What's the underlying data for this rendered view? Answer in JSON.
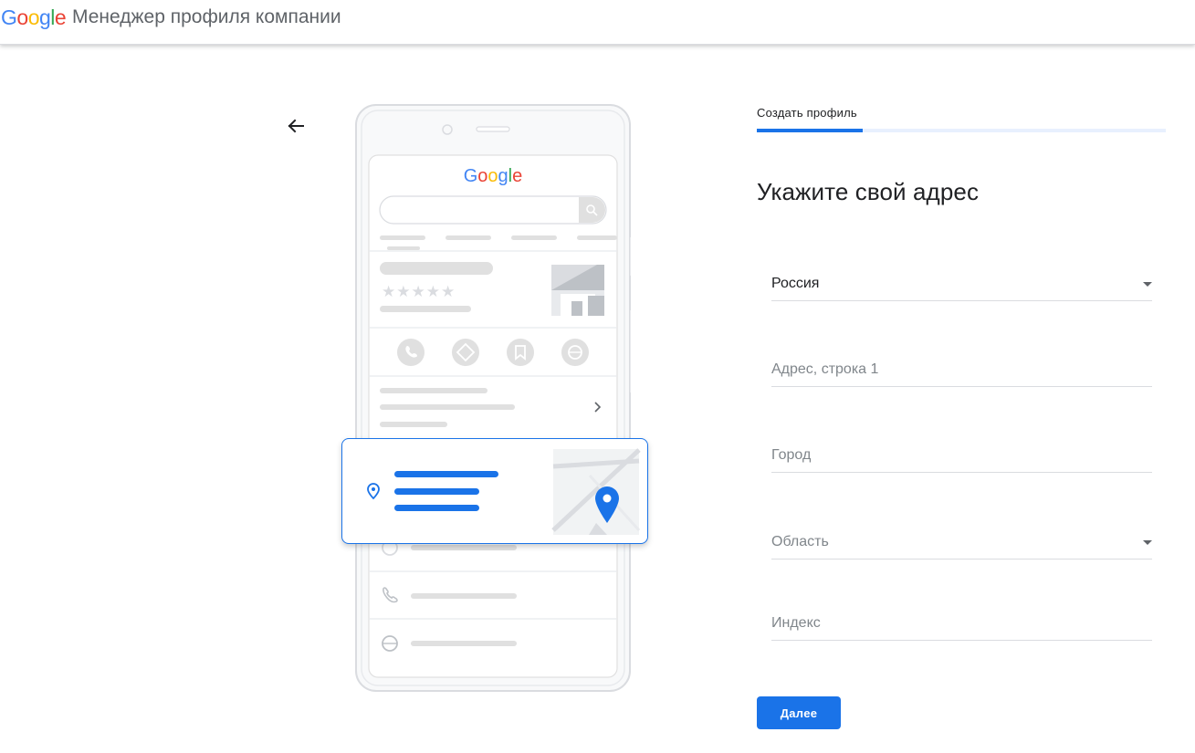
{
  "header": {
    "logo_letters": [
      "G",
      "o",
      "o",
      "g",
      "l",
      "e"
    ],
    "app_title": "Менеджер профиля компании"
  },
  "illustration": {
    "google_word": "Google",
    "stars": "★★★★★"
  },
  "form": {
    "step_label": "Создать профиль",
    "progress": 0.26,
    "title": "Укажите свой адрес",
    "country": {
      "value": "Россия"
    },
    "address_line1": {
      "placeholder": "Адрес, строка 1"
    },
    "city": {
      "placeholder": "Город"
    },
    "region": {
      "placeholder": "Область"
    },
    "postal": {
      "placeholder": "Индекс"
    },
    "next_button": "Далее"
  },
  "colors": {
    "accent": "#1a73e8",
    "google_blue": "#4285F4",
    "google_red": "#EA4335",
    "google_yellow": "#FBBC05",
    "google_green": "#34A853"
  }
}
